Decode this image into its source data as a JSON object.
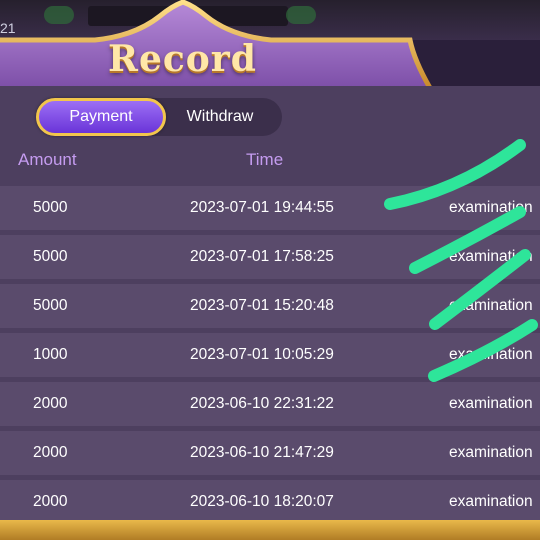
{
  "status_bar": {
    "left_text": "21"
  },
  "header": {
    "title": "Record"
  },
  "tabs": [
    {
      "label": "Payment",
      "active": true
    },
    {
      "label": "Withdraw",
      "active": false
    }
  ],
  "columns": {
    "amount": "Amount",
    "time": "Time"
  },
  "rows": [
    {
      "amount": "5000",
      "time": "2023-07-01 19:44:55",
      "status": "examination"
    },
    {
      "amount": "5000",
      "time": "2023-07-01 17:58:25",
      "status": "examination"
    },
    {
      "amount": "5000",
      "time": "2023-07-01 15:20:48",
      "status": "examination"
    },
    {
      "amount": "1000",
      "time": "2023-07-01 10:05:29",
      "status": "examination"
    },
    {
      "amount": "2000",
      "time": "2023-06-10 22:31:22",
      "status": "examination"
    },
    {
      "amount": "2000",
      "time": "2023-06-10 21:47:29",
      "status": "examination"
    },
    {
      "amount": "2000",
      "time": "2023-06-10 18:20:07",
      "status": "examination"
    }
  ],
  "colors": {
    "accent_purple": "#7a3fe0",
    "gold": "#f2c64c",
    "mark_green": "#2ee59a"
  }
}
